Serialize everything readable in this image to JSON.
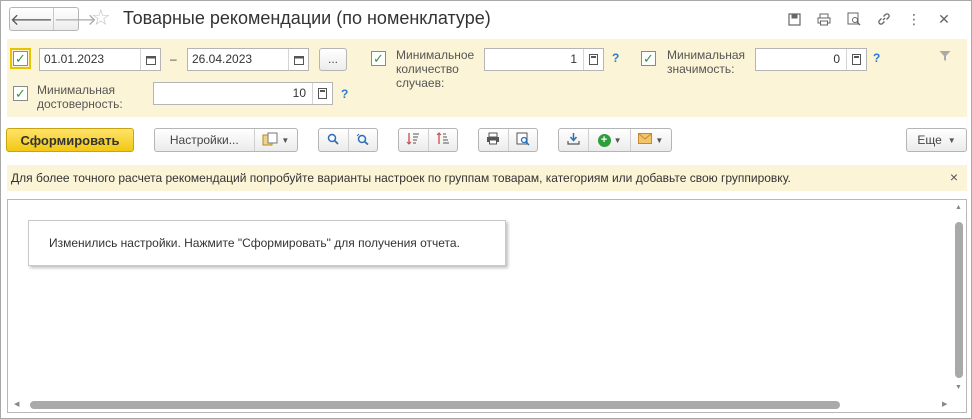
{
  "window": {
    "title": "Товарные рекомендации (по номенклатуре)",
    "nav": {
      "back_icon": "arrow-left-icon",
      "forward_icon": "arrow-right-icon"
    },
    "favorite_icon": "star-icon",
    "header_icons": [
      "save-icon",
      "print-icon",
      "preview-icon",
      "link-icon",
      "more-icon",
      "close-icon"
    ]
  },
  "filters": {
    "period": {
      "checked": true,
      "date_from": "01.01.2023",
      "separator": "–",
      "date_to": "26.04.2023",
      "select_label": "..."
    },
    "min_cases": {
      "checked": true,
      "label_line1": "Минимальное",
      "label_line2": "количество",
      "label_line3": "случаев:",
      "value": "1",
      "help": "?"
    },
    "min_significance": {
      "checked": true,
      "label_line1": "Минимальная",
      "label_line2": "значимость:",
      "value": "0",
      "help": "?"
    },
    "min_reliability": {
      "checked": true,
      "label_line1": "Минимальная",
      "label_line2": "достоверность:",
      "value": "10",
      "help": "?"
    }
  },
  "toolbar": {
    "generate_label": "Сформировать",
    "settings_label": "Настройки...",
    "more_label": "Еще"
  },
  "info": {
    "message": "Для более точного расчета рекомендаций попробуйте варианты настроек по группам товарам, категориям или добавьте свою группировку.",
    "close": "×"
  },
  "report": {
    "notice": "Изменились настройки. Нажмите \"Сформировать\" для получения отчета."
  },
  "colors": {
    "accent": "#f2c813",
    "panel_bg": "#fbf4d6",
    "check_green": "#2f9a3a",
    "help_blue": "#2b7bd3"
  }
}
